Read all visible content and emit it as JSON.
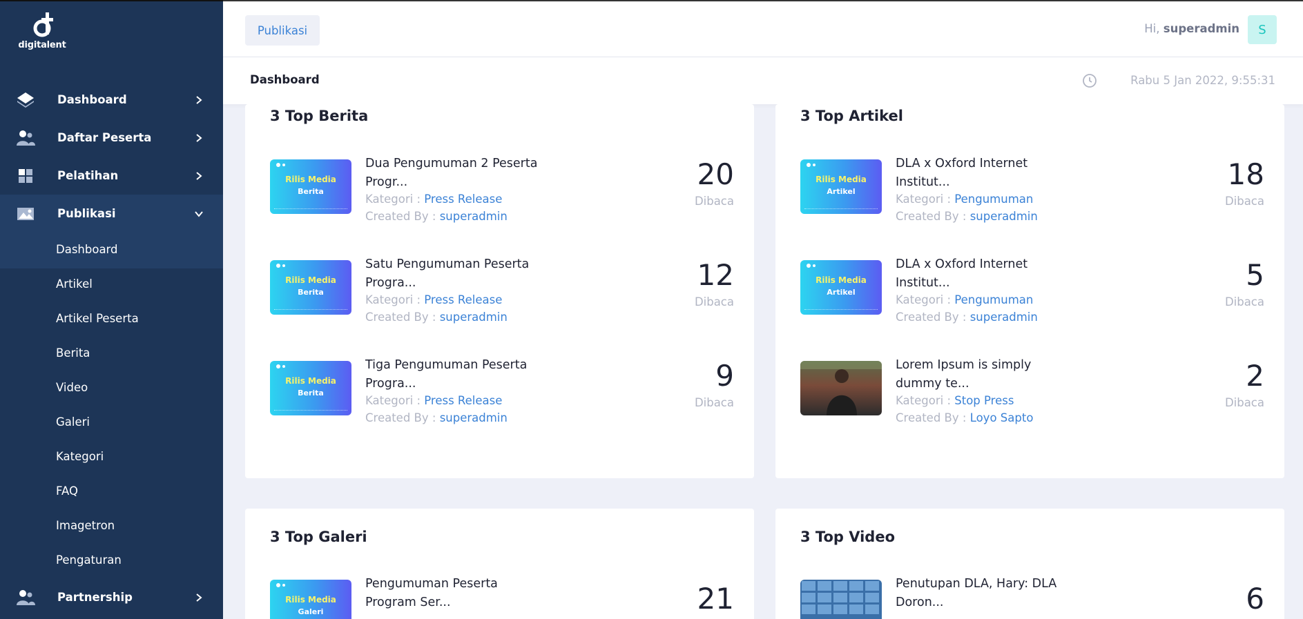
{
  "brand": {
    "name": "digitalent"
  },
  "sidebar": {
    "items": [
      {
        "label": "Dashboard",
        "icon": "layers-icon"
      },
      {
        "label": "Daftar Peserta",
        "icon": "users-icon"
      },
      {
        "label": "Pelatihan",
        "icon": "grid-icon"
      },
      {
        "label": "Publikasi",
        "icon": "image-icon"
      },
      {
        "label": "Partnership",
        "icon": "users-icon"
      }
    ],
    "sub_items": [
      "Dashboard",
      "Artikel",
      "Artikel Peserta",
      "Berita",
      "Video",
      "Galeri",
      "Kategori",
      "FAQ",
      "Imagetron",
      "Pengaturan"
    ]
  },
  "topbar": {
    "breadcrumb": "Publikasi",
    "greeting_prefix": "Hi,",
    "username": "superadmin",
    "avatar_initial": "S"
  },
  "subheader": {
    "title": "Dashboard",
    "datetime": "Rabu 5 Jan 2022, 9:55:31"
  },
  "cards": {
    "berita": {
      "title": "3 Top Berita",
      "rows": [
        {
          "title": "Dua Pengumuman 2 Peserta Progr...",
          "kategori_label": "Kategori :",
          "kategori": "Press Release",
          "created_label": "Created By :",
          "created_by": "superadmin",
          "count": "20",
          "unit": "Dibaca",
          "thumb_line1": "Rilis Media",
          "thumb_line2": "Berita"
        },
        {
          "title": "Satu Pengumuman Peserta Progra...",
          "kategori_label": "Kategori :",
          "kategori": "Press Release",
          "created_label": "Created By :",
          "created_by": "superadmin",
          "count": "12",
          "unit": "Dibaca",
          "thumb_line1": "Rilis Media",
          "thumb_line2": "Berita"
        },
        {
          "title": "Tiga Pengumuman Peserta Progra...",
          "kategori_label": "Kategori :",
          "kategori": "Press Release",
          "created_label": "Created By :",
          "created_by": "superadmin",
          "count": "9",
          "unit": "Dibaca",
          "thumb_line1": "Rilis Media",
          "thumb_line2": "Berita"
        }
      ]
    },
    "artikel": {
      "title": "3 Top Artikel",
      "rows": [
        {
          "title": "DLA x Oxford Internet Institut...",
          "kategori_label": "Kategori :",
          "kategori": "Pengumuman",
          "created_label": "Created By :",
          "created_by": "superadmin",
          "count": "18",
          "unit": "Dibaca",
          "thumb_line1": "Rilis Media",
          "thumb_line2": "Artikel"
        },
        {
          "title": "DLA x Oxford Internet Institut...",
          "kategori_label": "Kategori :",
          "kategori": "Pengumuman",
          "created_label": "Created By :",
          "created_by": "superadmin",
          "count": "5",
          "unit": "Dibaca",
          "thumb_line1": "Rilis Media",
          "thumb_line2": "Artikel"
        },
        {
          "title": "Lorem Ipsum is simply dummy te...",
          "kategori_label": "Kategori :",
          "kategori": "Stop Press",
          "created_label": "Created By :",
          "created_by": "Loyo Sapto",
          "count": "2",
          "unit": "Dibaca"
        }
      ]
    },
    "galeri": {
      "title": "3 Top Galeri",
      "rows": [
        {
          "title": "Pengumuman Peserta Program Ser...",
          "count": "21",
          "thumb_line1": "Rilis Media",
          "thumb_line2": "Galeri"
        }
      ]
    },
    "video": {
      "title": "3 Top Video",
      "rows": [
        {
          "title": "Penutupan DLA, Hary: DLA Doron...",
          "count": "6"
        }
      ]
    }
  },
  "colors": {
    "sidebar_bg": "#1d3557",
    "accent_link": "#3b82d6",
    "page_bg": "#eef0f8",
    "avatar_bg": "#c9f4f1",
    "avatar_fg": "#1bc5bd"
  }
}
